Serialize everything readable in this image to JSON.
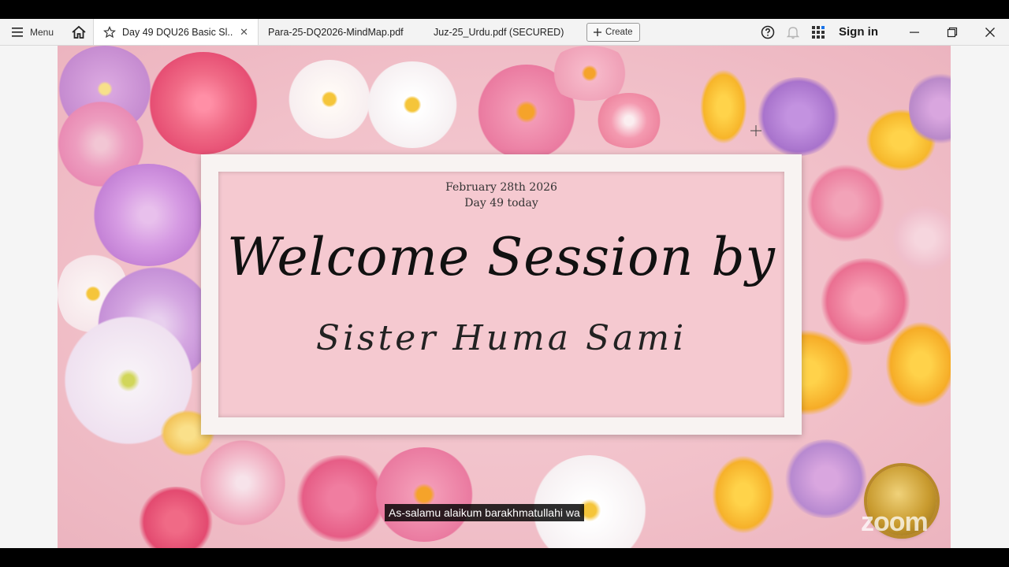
{
  "toolbar": {
    "menu_label": "Menu",
    "tabs": [
      {
        "label": "Day 49 DQU26 Basic Sl..."
      },
      {
        "label": "Para-25-DQ2026-MindMap.pdf"
      },
      {
        "label": "Juz-25_Urdu.pdf (SECURED)"
      }
    ],
    "create_label": "Create",
    "sign_in_label": "Sign in"
  },
  "slide": {
    "date": "February 28th 2026",
    "day": "Day 49  today",
    "title": "Welcome Session by",
    "presenter": "Sister Huma Sami"
  },
  "caption": "As-salamu alaikum barakhmatullahi wa",
  "watermark": "zoom",
  "colors": {
    "toolbar_bg": "#f3f3f3",
    "slide_pink": "#f1c0c9",
    "frame_white": "#f8f3f2"
  },
  "icons": [
    "hamburger-icon",
    "home-icon",
    "star-icon",
    "close-icon",
    "plus-icon",
    "help-icon",
    "bell-icon",
    "apps-grid-icon",
    "minimize-icon",
    "restore-icon",
    "window-close-icon"
  ]
}
